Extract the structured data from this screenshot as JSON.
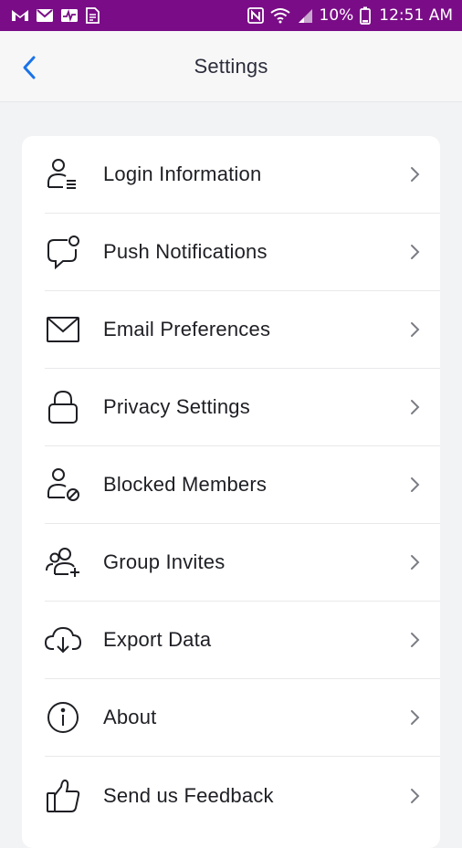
{
  "status_bar": {
    "left_icons": [
      "gmail-icon",
      "email-icon",
      "activity-icon",
      "document-icon"
    ],
    "right_icons": [
      "nfc-icon",
      "wifi-icon",
      "signal-icon",
      "battery-icon"
    ],
    "battery_percent": "10%",
    "time": "12:51 AM",
    "background_color": "#7a0d87"
  },
  "header": {
    "title": "Settings",
    "back_icon": "chevron-left-icon",
    "accent_color": "#1a73e8"
  },
  "settings": {
    "items": [
      {
        "label": "Login Information",
        "icon": "user-list-icon"
      },
      {
        "label": "Push Notifications",
        "icon": "chat-notification-icon"
      },
      {
        "label": "Email Preferences",
        "icon": "envelope-icon"
      },
      {
        "label": "Privacy Settings",
        "icon": "lock-icon"
      },
      {
        "label": "Blocked Members",
        "icon": "user-blocked-icon"
      },
      {
        "label": "Group Invites",
        "icon": "group-add-icon"
      },
      {
        "label": "Export Data",
        "icon": "cloud-download-icon"
      },
      {
        "label": "About",
        "icon": "info-icon"
      },
      {
        "label": "Send us Feedback",
        "icon": "thumbs-up-icon"
      }
    ]
  }
}
